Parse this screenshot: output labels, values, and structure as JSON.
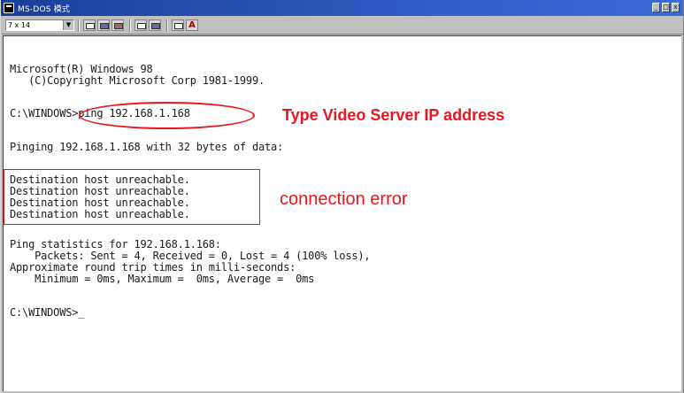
{
  "window": {
    "title": "MS-DOS 模式",
    "buttons": [
      "_",
      "□",
      "x"
    ]
  },
  "toolbar": {
    "font_size": "7 x 14",
    "font_button": "A"
  },
  "console": {
    "lines": [
      "Microsoft(R) Windows 98",
      "   (C)Copyright Microsoft Corp 1981-1999.",
      "C:\\WINDOWS>ping 192.168.1.168",
      "Pinging 192.168.1.168 with 32 bytes of data:",
      "Destination host unreachable.",
      "Destination host unreachable.",
      "Destination host unreachable.",
      "Destination host unreachable.",
      "Ping statistics for 192.168.1.168:",
      "    Packets: Sent = 4, Received = 0, Lost = 4 (100% loss),",
      "Approximate round trip times in milli-seconds:",
      "    Minimum = 0ms, Maximum =  0ms, Average =  0ms",
      "C:\\WINDOWS>_"
    ]
  },
  "annotations": {
    "ip_label": "Type Video Server IP address",
    "error_label": "connection error",
    "color": "#e8161f"
  }
}
